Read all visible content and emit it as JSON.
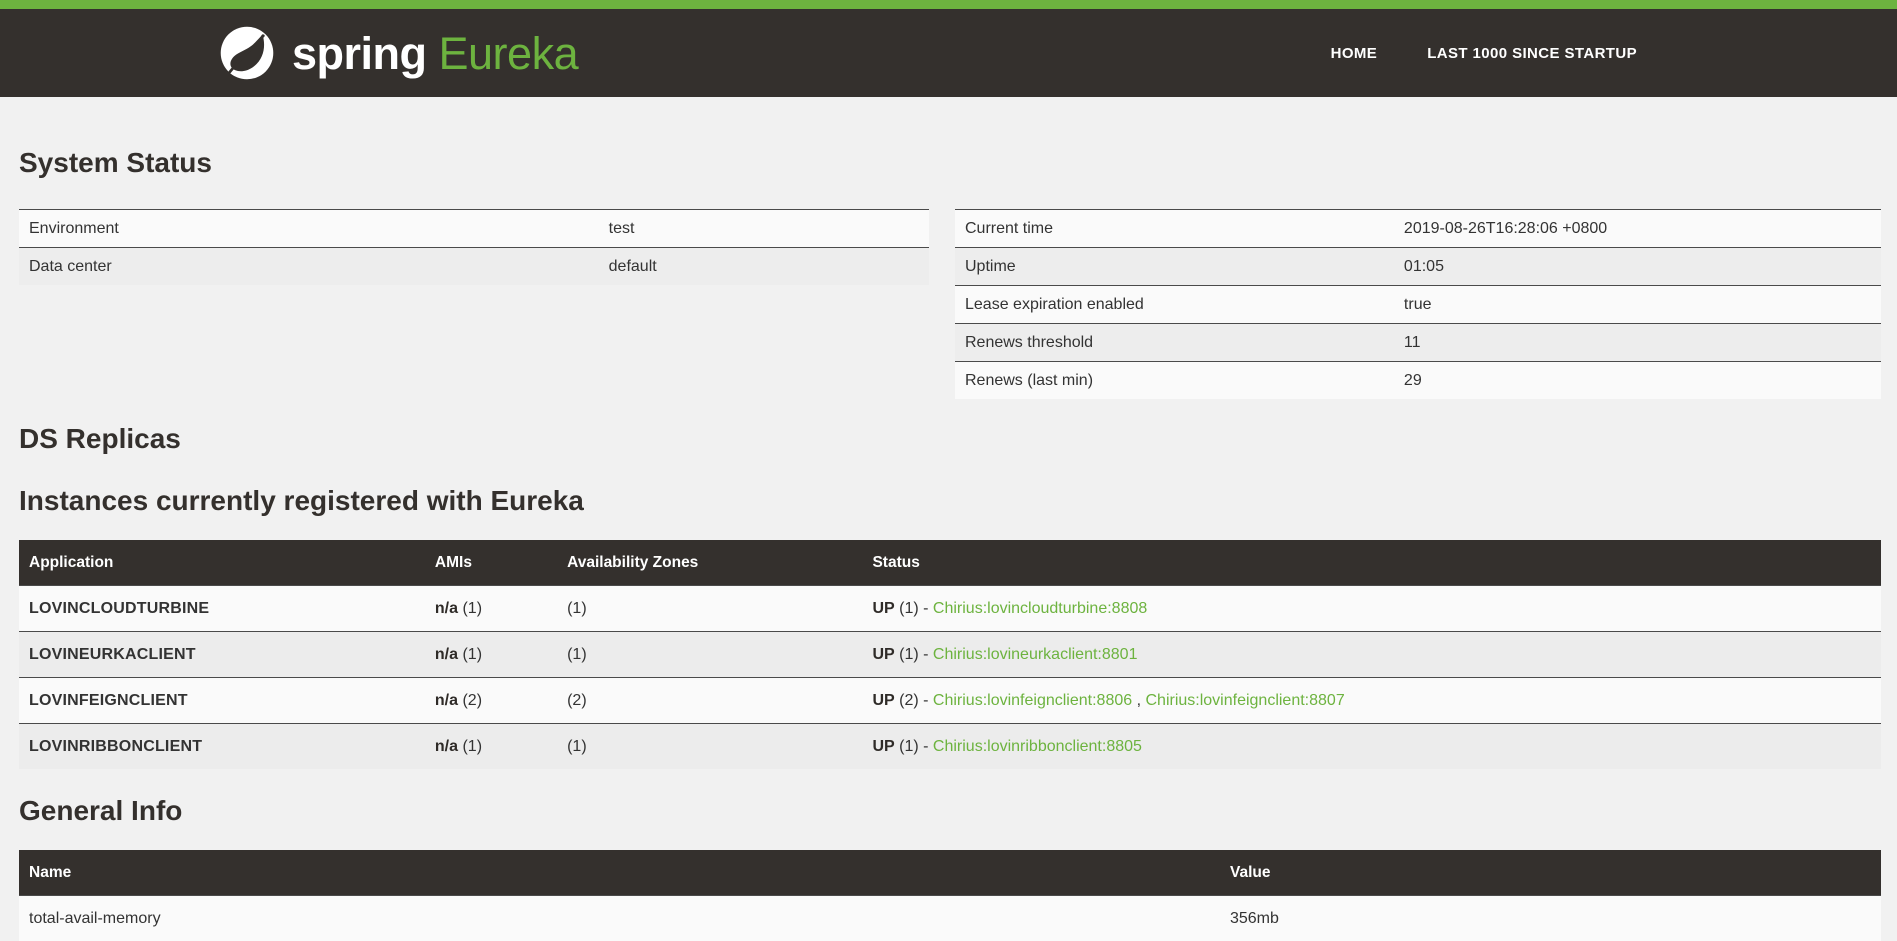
{
  "colors": {
    "accent_green": "#6db33f",
    "header_dark": "#34302d",
    "link_green": "#6db33f",
    "page_background": "#f1f1f1"
  },
  "header": {
    "brand_spring": "spring",
    "brand_app": "Eureka",
    "leaf_icon": "spring-leaf-icon",
    "nav": [
      {
        "label": "HOME"
      },
      {
        "label": "LAST 1000 SINCE STARTUP"
      }
    ]
  },
  "system_status": {
    "title": "System Status",
    "left_rows": [
      [
        "Environment",
        "test"
      ],
      [
        "Data center",
        "default"
      ]
    ],
    "right_rows": [
      [
        "Current time",
        "2019-08-26T16:28:06 +0800"
      ],
      [
        "Uptime",
        "01:05"
      ],
      [
        "Lease expiration enabled",
        "true"
      ],
      [
        "Renews threshold",
        "11"
      ],
      [
        "Renews (last min)",
        "29"
      ]
    ]
  },
  "ds_replicas": {
    "title": "DS Replicas"
  },
  "instances": {
    "title": "Instances currently registered with Eureka",
    "columns": [
      "Application",
      "AMIs",
      "Availability Zones",
      "Status"
    ],
    "rows": [
      {
        "app": "LOVINCLOUDTURBINE",
        "amis": "n/a",
        "amis_count": "(1)",
        "zones": "(1)",
        "status": "UP",
        "status_count": "(1)",
        "instances": [
          "Chirius:lovincloudturbine:8808"
        ]
      },
      {
        "app": "LOVINEURKACLIENT",
        "amis": "n/a",
        "amis_count": "(1)",
        "zones": "(1)",
        "status": "UP",
        "status_count": "(1)",
        "instances": [
          "Chirius:lovineurkaclient:8801"
        ]
      },
      {
        "app": "LOVINFEIGNCLIENT",
        "amis": "n/a",
        "amis_count": "(2)",
        "zones": "(2)",
        "status": "UP",
        "status_count": "(2)",
        "instances": [
          "Chirius:lovinfeignclient:8806",
          "Chirius:lovinfeignclient:8807"
        ]
      },
      {
        "app": "LOVINRIBBONCLIENT",
        "amis": "n/a",
        "amis_count": "(1)",
        "zones": "(1)",
        "status": "UP",
        "status_count": "(1)",
        "instances": [
          "Chirius:lovinribbonclient:8805"
        ]
      }
    ]
  },
  "general_info": {
    "title": "General Info",
    "columns": [
      "Name",
      "Value"
    ],
    "rows": [
      [
        "total-avail-memory",
        "356mb"
      ]
    ]
  }
}
